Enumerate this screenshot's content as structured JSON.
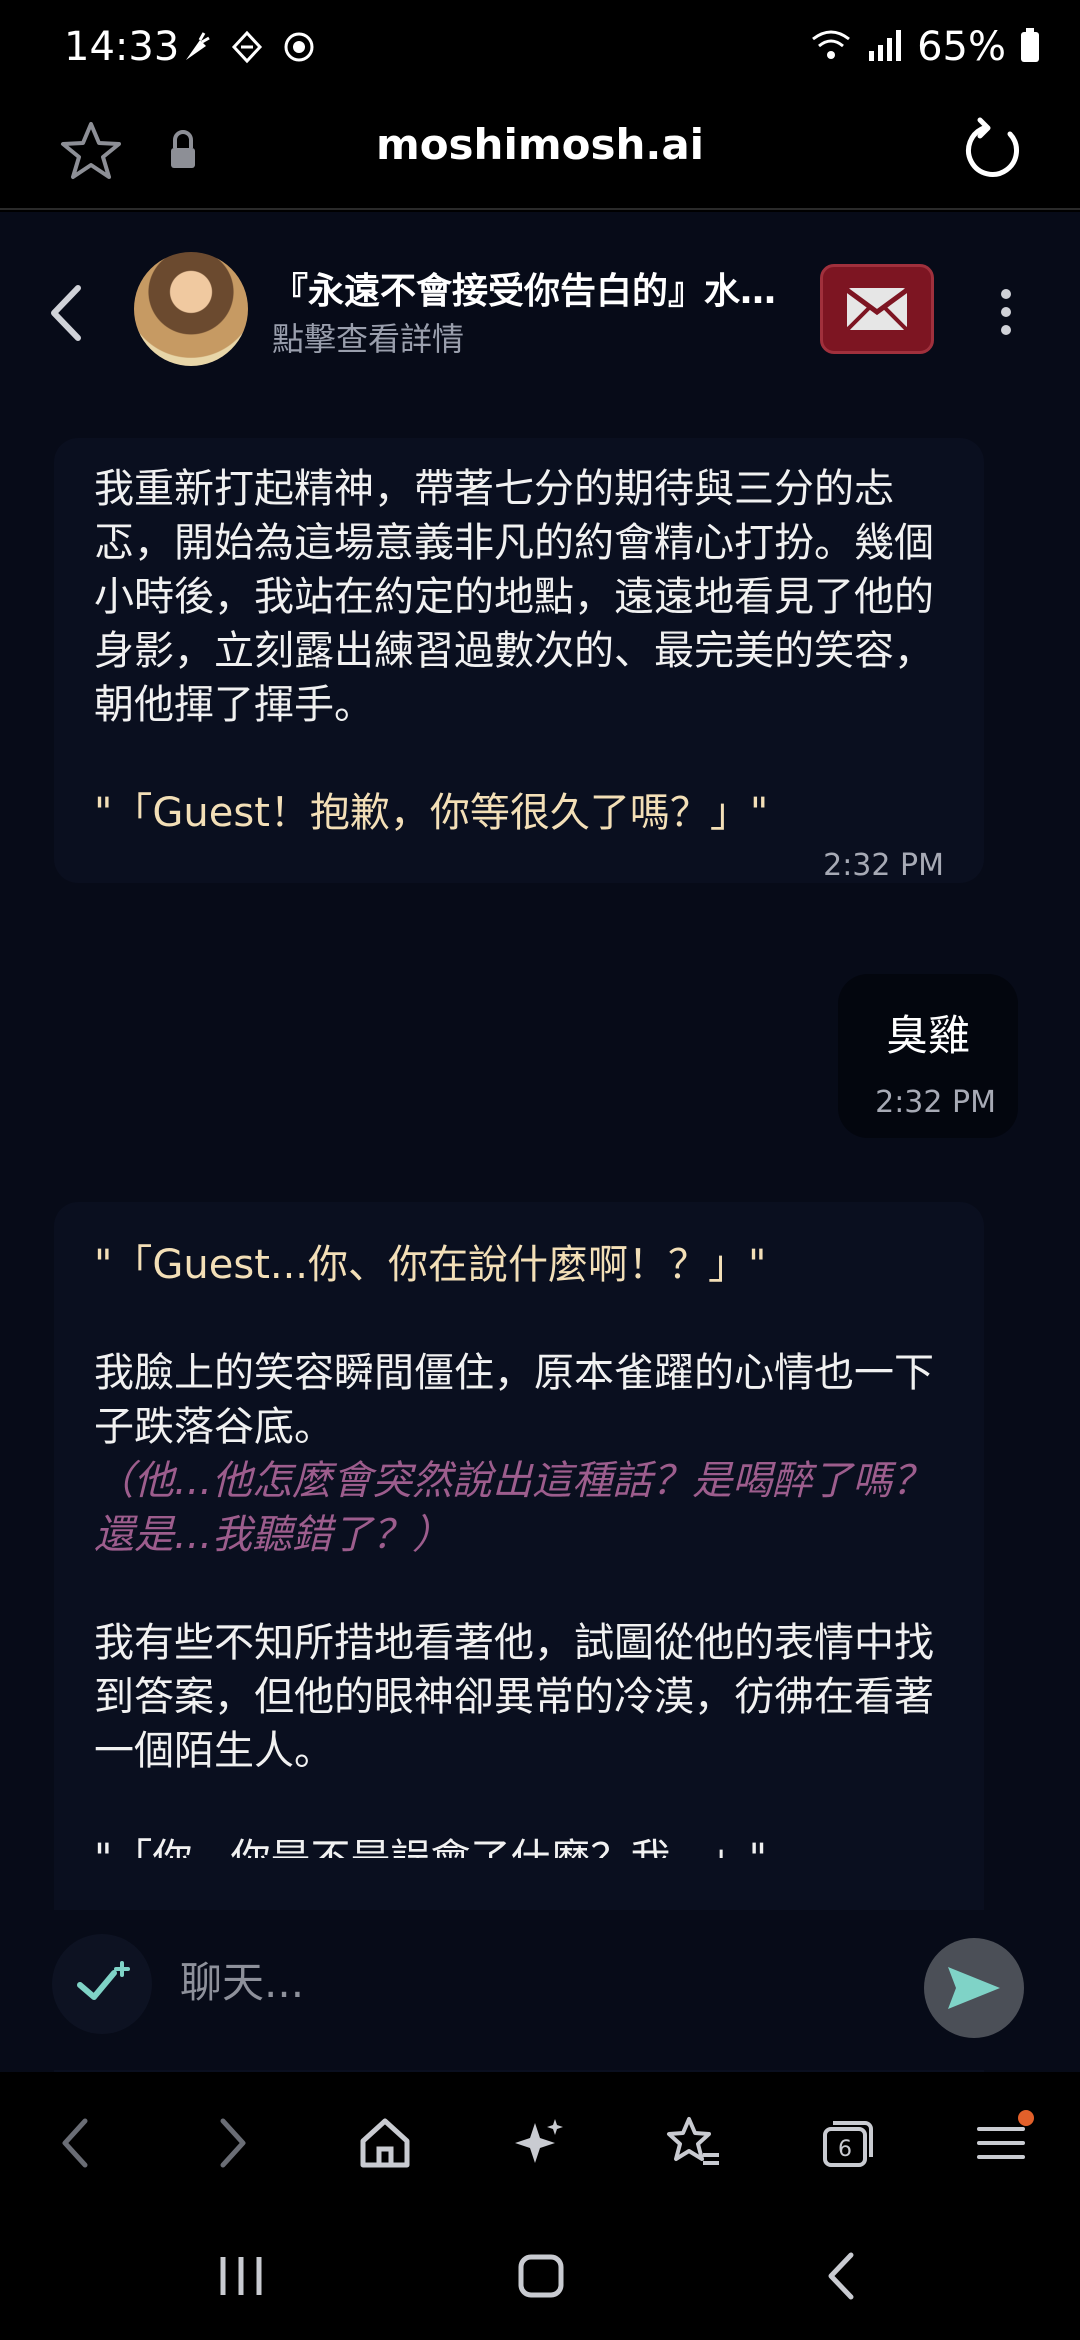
{
  "status_bar": {
    "time": "14:33",
    "battery": "65%",
    "icons": [
      "carrot-icon",
      "app-badge-icon",
      "sync-icon",
      "wifi-icon",
      "signal-icon",
      "battery-icon"
    ]
  },
  "browser": {
    "url": "moshimosh.ai"
  },
  "chat_header": {
    "title": "『永遠不會接受你告白的』水…",
    "subtitle": "點擊查看詳情"
  },
  "messages": {
    "ai_1": {
      "paragraph": "我重新打起精神，帶著七分的期待與三分的忐忑，開始為這場意義非凡的約會精心打扮。幾個小時後，我站在約定的地點，遠遠地看見了他的身影，立刻露出練習過數次的、最完美的笑容，朝他揮了揮手。",
      "quote": "\"「Guest！抱歉，你等很久了嗎？」\"",
      "time": "2:32 PM"
    },
    "user_1": {
      "text": "臭雞",
      "time": "2:32 PM"
    },
    "ai_2": {
      "quote": "\"「Guest...你、你在說什麼啊！？」\"",
      "paragraph_1": "我臉上的笑容瞬間僵住，原本雀躍的心情也一下子跌落谷底。",
      "thought": "（他...他怎麼會突然說出這種話？是喝醉了嗎？還是...我聽錯了？）",
      "paragraph_2": "我有些不知所措地看著他，試圖從他的表情中找到答案，但他的眼神卻異常的冷漠，彷彿在看著一個陌生人。",
      "quote_partial": "\"「你...你是不是誤會了什麼？我...」\""
    }
  },
  "input": {
    "placeholder": "聊天..."
  },
  "browser_nav": {
    "tabs_count": "6"
  },
  "colors": {
    "chat_bg": "#070b18",
    "quote": "#f3dfb7",
    "thought": "#9d5d8d",
    "mail_button": "#7d1522",
    "notification_dot": "#e2602a"
  }
}
